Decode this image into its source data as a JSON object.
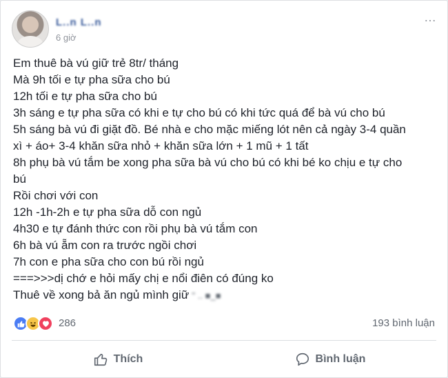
{
  "post": {
    "author": "L..n L..n",
    "time": "6 giờ",
    "more_icon": "…",
    "lines": [
      "Em thuê bà vú giữ trẻ 8tr/ tháng",
      "Mà 9h tối e tự pha sữa cho bú",
      "12h tối e tự pha sữa cho bú",
      "3h sáng e tự pha sữa có khi e tự cho bú có khi tức quá để bà vú cho bú",
      "5h sáng bà vú đi giặt đồ. Bé nhà e cho mặc miếng lót nên cả ngày 3-4 quần",
      "xì + áo+ 3-4 khăn sữa nhỏ + khăn sữa lớn + 1 mũ + 1 tất",
      "8h phụ bà vú tắm be xong pha sữa bà vú cho bú có khi bé ko chịu e tự cho",
      "bú",
      "Rồi chơi với con",
      "12h -1h-2h e tự pha sữa dỗ con ngủ",
      "4h30 e tự đánh thức con rồi phụ bà vú tắm con",
      "6h bà vú ẵm con ra trước ngồi chơi",
      "7h con e pha sữa cho con bú rồi ngủ",
      "===>>>dị chớ e hỏi mấy chị e nổi điên có đúng ko",
      "Thuê về xong bả ăn ngủ mình giữ"
    ],
    "last_line_tail": "'' ..  ■_■"
  },
  "stats": {
    "reactions": [
      "like-reaction-icon",
      "haha-reaction-icon",
      "love-reaction-icon"
    ],
    "reaction_count": "286",
    "comment_count": "193 bình luận"
  },
  "actions": {
    "like_label": "Thích",
    "comment_label": "Bình luận"
  },
  "colors": {
    "author": "#365899",
    "like_reaction": "#4a7cf4",
    "haha_reaction": "#f7c548",
    "love_reaction": "#f0405d",
    "muted_text": "#606770"
  }
}
